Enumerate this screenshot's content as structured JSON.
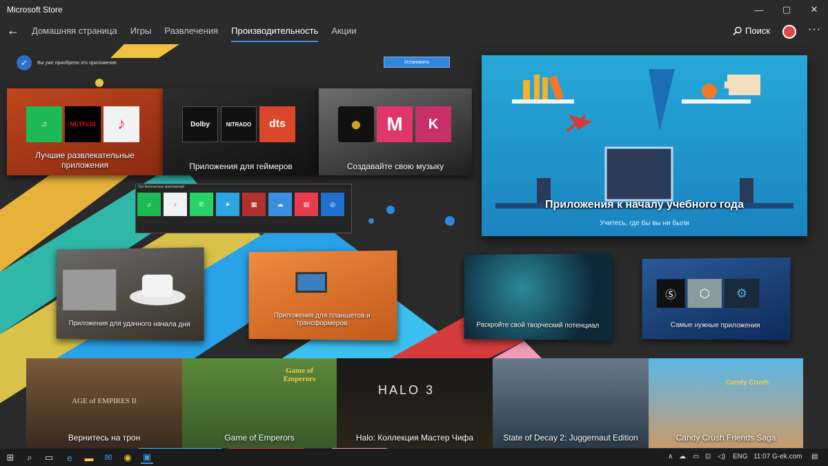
{
  "window": {
    "title": "Microsoft Store",
    "minimize": "—",
    "maximize": "▢",
    "close": "✕"
  },
  "nav": {
    "back": "←",
    "tabs": [
      {
        "label": "Домашняя страница"
      },
      {
        "label": "Игры"
      },
      {
        "label": "Развлечения"
      },
      {
        "label": "Производительность",
        "active": true
      },
      {
        "label": "Акции"
      }
    ],
    "search_label": "Поиск",
    "more": "···"
  },
  "owned": {
    "text": "Вы уже приобрели это приложение.",
    "install_label": "Установить"
  },
  "top_collections": [
    {
      "label": "Лучшие развлекательные приложения",
      "icons": [
        {
          "name": "spotify-icon",
          "text": "♫",
          "color": "#1db954"
        },
        {
          "name": "netflix-icon",
          "text": "NETFLIX",
          "color": "#000000"
        },
        {
          "name": "itunes-icon",
          "text": "♪",
          "color": "#f2f2f2"
        }
      ]
    },
    {
      "label": "Приложения для геймеров",
      "icons": [
        {
          "name": "dolby-icon",
          "text": "Dolby",
          "color": "#111111"
        },
        {
          "name": "nitrado-icon",
          "text": "NITRADO",
          "color": "#111111"
        },
        {
          "name": "dts-icon",
          "text": "dts",
          "color": "#d9482b"
        }
      ]
    },
    {
      "label": "Создавайте свою музыку",
      "icons": [
        {
          "name": "vinyl-icon",
          "text": "●",
          "color": "#111111"
        },
        {
          "name": "m-app-icon",
          "text": "M",
          "color": "#e0366b"
        },
        {
          "name": "k-app-icon",
          "text": "K",
          "color": "#c8306a"
        }
      ]
    }
  ],
  "edu": {
    "title": "Приложения к началу учебного года",
    "subtitle": "Учитесь, где бы вы ни были"
  },
  "free_strip": {
    "caption": "Топ бесплатных приложений",
    "apps": [
      {
        "name": "spotify-icon",
        "text": "♫",
        "color": "#1db954"
      },
      {
        "name": "itunes-icon",
        "text": "♪",
        "color": "#f2f2f2"
      },
      {
        "name": "whatsapp-icon",
        "text": "✆",
        "color": "#25d366"
      },
      {
        "name": "telegram-icon",
        "text": "➤",
        "color": "#2ca5e0"
      },
      {
        "name": "winrar-icon",
        "text": "▦",
        "color": "#b0322c"
      },
      {
        "name": "icloud-icon",
        "text": "☁",
        "color": "#3b8fe0"
      },
      {
        "name": "library-icon",
        "text": "▤",
        "color": "#e83c4c"
      },
      {
        "name": "instagram-icon",
        "text": "◎",
        "color": "#1f6fcf"
      }
    ]
  },
  "mid_collections": [
    {
      "label": "Приложения для удачного начала дня"
    },
    {
      "label": "Приложения для планшетов и трансформеров"
    },
    {
      "label": "Раскройте свой творческий потенциал"
    },
    {
      "label": "Самые нужные приложения"
    }
  ],
  "games": [
    {
      "label": "Вернитесь на трон",
      "logo": "AGE of EMPIRES II"
    },
    {
      "label": "Game of Emperors",
      "logo": "Game of Emperors"
    },
    {
      "label": "Halo: Коллекция Мастер Чифа",
      "logo": "HALO 3"
    },
    {
      "label": "State of Decay 2: Juggernaut Edition",
      "logo": ""
    },
    {
      "label": "Candy Crush Friends Saga",
      "logo": "Candy Crush"
    }
  ],
  "taskbar": {
    "lang": "ENG",
    "clock": "11:07 G-ek.com"
  }
}
